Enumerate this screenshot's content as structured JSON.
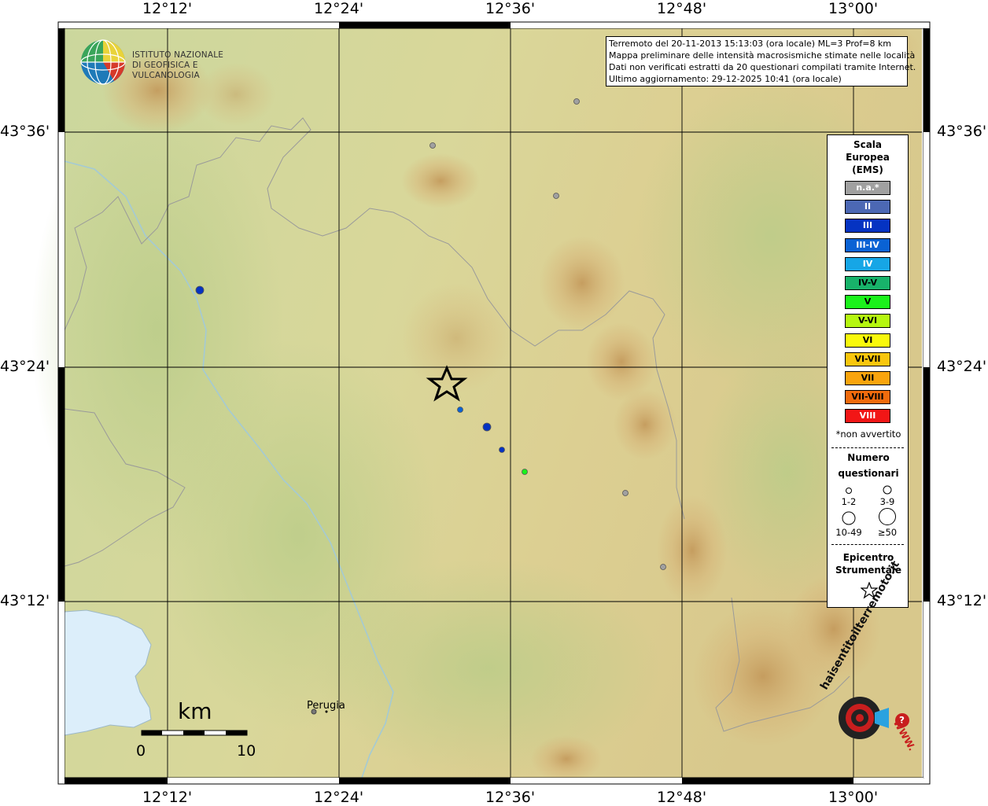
{
  "coords": {
    "top_lon": [
      "12°12'",
      "12°24'",
      "12°36'",
      "12°48'",
      "13°00'"
    ],
    "bottom_lon": [
      "12°12'",
      "12°24'",
      "12°36'",
      "12°48'",
      "13°00'"
    ],
    "left_lat": [
      "43°36'",
      "43°24'",
      "43°12'"
    ],
    "right_lat": [
      "43°36'",
      "43°24'",
      "43°12'"
    ]
  },
  "logo": {
    "line1": "ISTITUTO NAZIONALE",
    "line2": "DI GEOFISICA E VULCANOLOGIA"
  },
  "info": {
    "line1": "Terremoto del 20-11-2013 15:13:03 (ora locale) ML=3 Prof=8 km",
    "line2": "Mappa preliminare delle intensità macrosismiche stimate nelle località",
    "line3": "Dati non verificati estratti da 20 questionari compilati tramite Internet.",
    "line4": "Ultimo aggiornamento: 29-12-2025 10:41 (ora locale)"
  },
  "legend": {
    "title1": "Scala",
    "title2": "Europea",
    "title3": "(EMS)",
    "items": [
      {
        "label": "n.a.*",
        "color": "#a0a0a0",
        "text_color": "#ffffff"
      },
      {
        "label": "II",
        "color": "#4c68b4",
        "text_color": "#ffffff"
      },
      {
        "label": "III",
        "color": "#0533c2",
        "text_color": "#ffffff"
      },
      {
        "label": "III-IV",
        "color": "#0a62d4",
        "text_color": "#ffffff"
      },
      {
        "label": "IV",
        "color": "#16a6e6",
        "text_color": "#ffffff"
      },
      {
        "label": "IV-V",
        "color": "#18b36a",
        "text_color": "#000000"
      },
      {
        "label": "V",
        "color": "#1bf21b",
        "text_color": "#000000"
      },
      {
        "label": "V-VI",
        "color": "#b5f70f",
        "text_color": "#000000"
      },
      {
        "label": "VI",
        "color": "#f9f90b",
        "text_color": "#000000"
      },
      {
        "label": "VI-VII",
        "color": "#f9c60c",
        "text_color": "#000000"
      },
      {
        "label": "VII",
        "color": "#f9a40d",
        "text_color": "#000000"
      },
      {
        "label": "VII-VIII",
        "color": "#f06b0d",
        "text_color": "#000000"
      },
      {
        "label": "VIII",
        "color": "#f21616",
        "text_color": "#ffffff"
      }
    ],
    "non_felt": "*non avvertito",
    "num_title1": "Numero",
    "num_title2": "questionari",
    "sizes": [
      "1-2",
      "3-9",
      "10-49",
      "≥50"
    ],
    "epi_title1": "Epicentro",
    "epi_title2": "Strumentale"
  },
  "scale": {
    "unit": "km",
    "start": "0",
    "end": "10"
  },
  "city": {
    "name": "Perugia"
  },
  "watermark": {
    "text": "haisentitoilterremoto.it",
    "url": "WWW."
  },
  "observations": [
    {
      "intensity": "n.a.*",
      "color": "#a0a0a0",
      "size_class": "1-2"
    },
    {
      "intensity": "n.a.*",
      "color": "#a0a0a0",
      "size_class": "1-2"
    },
    {
      "intensity": "n.a.*",
      "color": "#a0a0a0",
      "size_class": "1-2"
    },
    {
      "intensity": "III",
      "color": "#0533c2",
      "size_class": "3-9"
    },
    {
      "intensity": "III-IV",
      "color": "#0a62d4",
      "size_class": "1-2"
    },
    {
      "intensity": "III",
      "color": "#0533c2",
      "size_class": "3-9"
    },
    {
      "intensity": "III",
      "color": "#0533c2",
      "size_class": "1-2"
    },
    {
      "intensity": "V",
      "color": "#1bf21b",
      "size_class": "1-2"
    },
    {
      "intensity": "n.a.*",
      "color": "#a0a0a0",
      "size_class": "1-2"
    },
    {
      "intensity": "n.a.*",
      "color": "#a0a0a0",
      "size_class": "1-2"
    }
  ],
  "colors": {
    "lake": "#dceefa",
    "relief_low": "#c9d69a",
    "relief_high": "#c8a060",
    "frame": "#000000"
  }
}
